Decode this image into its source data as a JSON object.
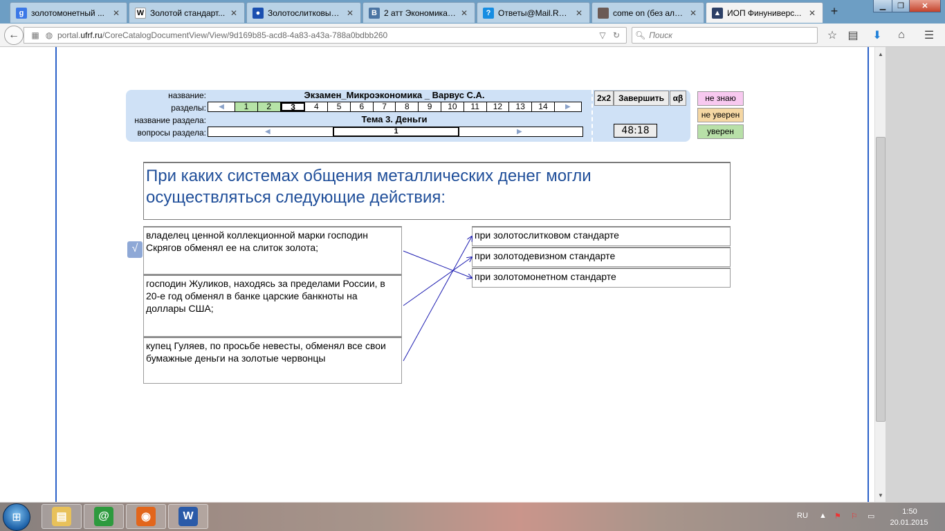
{
  "browser": {
    "tabs": [
      {
        "title": "золотомонетный ...",
        "icon": "google-icon",
        "color": "#3b78e7",
        "glyph": "g",
        "active": false
      },
      {
        "title": "Золотой стандарт...",
        "icon": "wikipedia-icon",
        "color": "#ffffff",
        "glyph": "W",
        "active": false
      },
      {
        "title": "Золотослитковый...",
        "icon": "site-icon",
        "color": "#1a4fb0",
        "glyph": "●",
        "active": false
      },
      {
        "title": "2 атт Экономика 2...",
        "icon": "vk-icon",
        "color": "#4c75a3",
        "glyph": "B",
        "active": false
      },
      {
        "title": "Ответы@Mail.Ru: ...",
        "icon": "mailru-answers-icon",
        "color": "#168de2",
        "glyph": "?",
        "active": false
      },
      {
        "title": "come on (без алф...",
        "icon": "photo-icon",
        "color": "#6b5a55",
        "glyph": "",
        "active": false
      },
      {
        "title": "ИОП Финуниверс...",
        "icon": "university-icon",
        "color": "#2b3f66",
        "glyph": "▲",
        "active": true
      }
    ],
    "new_tab_label": "+",
    "url_prefix": "portal.",
    "url_domain": "ufrf.ru",
    "url_path": "/CoreCatalogDocumentView/View/9d169b85-acd8-4a83-a43a-788a0bdbb260",
    "search_placeholder": "Поиск"
  },
  "exam": {
    "labels": {
      "name": "название:",
      "sections": "разделы:",
      "section_name": "название раздела:",
      "section_questions": "вопросы раздела:"
    },
    "title": "Экзамен_Микроэкономика _ Варвус С.А.",
    "sections": [
      "1",
      "2",
      "3",
      "4",
      "5",
      "6",
      "7",
      "8",
      "9",
      "10",
      "11",
      "12",
      "13",
      "14"
    ],
    "completed_sections": [
      "1",
      "2"
    ],
    "current_section": "3",
    "section_title": "Тема 3. Деньги",
    "current_question": "1",
    "buttons": {
      "mode_2x2": "2x2",
      "finish": "Завершить",
      "alphabet": "αβ"
    },
    "timer": "48:18",
    "confidence": {
      "dont_know": "не знаю",
      "not_sure": "не уверен",
      "sure": "уверен",
      "dont_know_color": "#f8c9f0",
      "not_sure_color": "#f5d7a3",
      "sure_color": "#b8e0a8"
    }
  },
  "question": {
    "text": "При каких системах общения металлических денег могли осуществляться следующие действия:",
    "left_items": [
      "владелец ценной коллекционной марки господин Скрягов обменял ее на слиток золота;",
      "господин Жуликов, находясь за пределами России, в 20-е год обменял в банке царские банкноты на доллары США;",
      "купец Гуляев, по просьбе невесты, обменял все свои бумажные деньги на золотые червонцы"
    ],
    "right_items": [
      "при золотослитковом стандарте",
      "при золотодевизном стандарте",
      "при золотомонетном стандарте"
    ],
    "matches": [
      [
        0,
        2
      ],
      [
        1,
        1
      ],
      [
        2,
        0
      ]
    ],
    "line_color": "#1a1ab0"
  },
  "taskbar": {
    "apps": [
      {
        "name": "explorer-icon",
        "color": "#e8c15a",
        "glyph": "▤"
      },
      {
        "name": "mail-agent-icon",
        "color": "#2e9a3e",
        "glyph": "@"
      },
      {
        "name": "firefox-icon",
        "color": "#e2661c",
        "glyph": "◉"
      },
      {
        "name": "word-icon",
        "color": "#2a5aa8",
        "glyph": "W"
      }
    ],
    "language": "RU",
    "time": "1:50",
    "date": "20.01.2015"
  }
}
